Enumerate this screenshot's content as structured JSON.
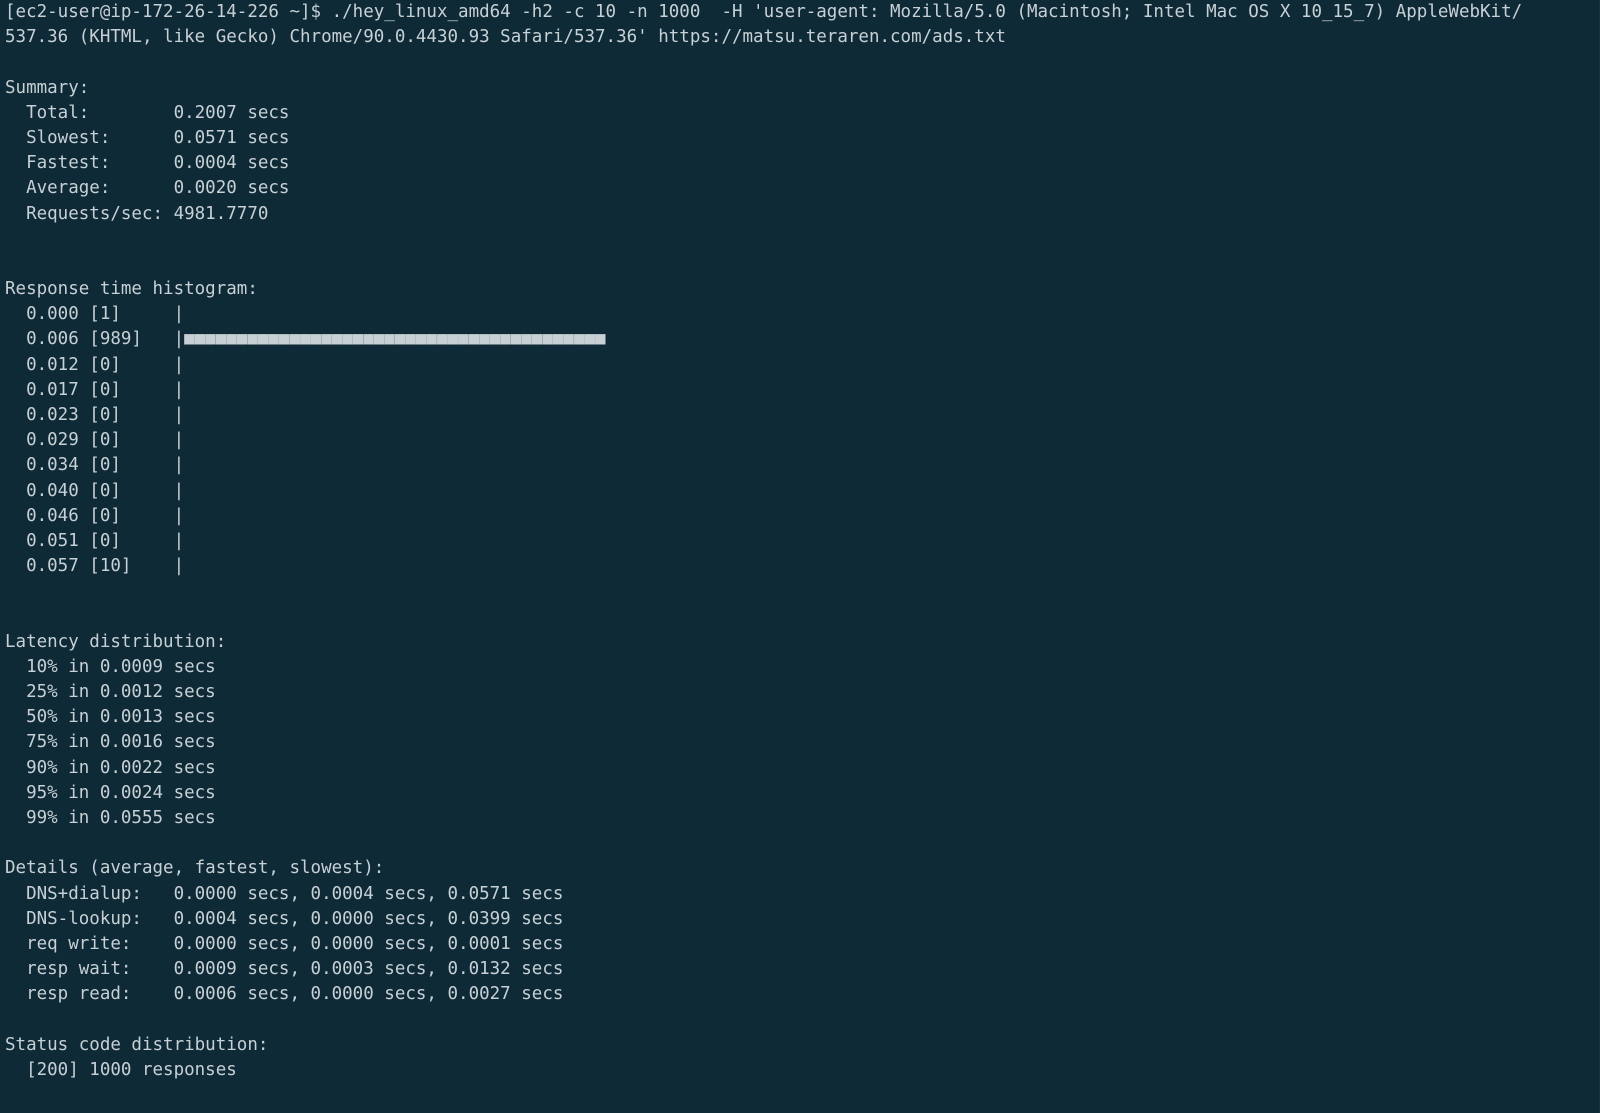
{
  "command": {
    "line1": "[ec2-user@ip-172-26-14-226 ~]$ ./hey_linux_amd64 -h2 -c 10 -n 1000  -H 'user-agent: Mozilla/5.0 (Macintosh; Intel Mac OS X 10_15_7) AppleWebKit/",
    "line2": "537.36 (KHTML, like Gecko) Chrome/90.0.4430.93 Safari/537.36' https://matsu.teraren.com/ads.txt"
  },
  "summary": {
    "heading": "Summary:",
    "lines": [
      "  Total:        0.2007 secs",
      "  Slowest:      0.0571 secs",
      "  Fastest:      0.0004 secs",
      "  Average:      0.0020 secs",
      "  Requests/sec: 4981.7770"
    ]
  },
  "histogram": {
    "heading": "Response time histogram:",
    "lines": [
      "  0.000 [1]     |",
      "  0.006 [989]   |■■■■■■■■■■■■■■■■■■■■■■■■■■■■■■■■■■■■■■■■",
      "  0.012 [0]     |",
      "  0.017 [0]     |",
      "  0.023 [0]     |",
      "  0.029 [0]     |",
      "  0.034 [0]     |",
      "  0.040 [0]     |",
      "  0.046 [0]     |",
      "  0.051 [0]     |",
      "  0.057 [10]    |"
    ]
  },
  "latency": {
    "heading": "Latency distribution:",
    "lines": [
      "  10% in 0.0009 secs",
      "  25% in 0.0012 secs",
      "  50% in 0.0013 secs",
      "  75% in 0.0016 secs",
      "  90% in 0.0022 secs",
      "  95% in 0.0024 secs",
      "  99% in 0.0555 secs"
    ]
  },
  "details": {
    "heading": "Details (average, fastest, slowest):",
    "lines": [
      "  DNS+dialup:   0.0000 secs, 0.0004 secs, 0.0571 secs",
      "  DNS-lookup:   0.0004 secs, 0.0000 secs, 0.0399 secs",
      "  req write:    0.0000 secs, 0.0000 secs, 0.0001 secs",
      "  resp wait:    0.0009 secs, 0.0003 secs, 0.0132 secs",
      "  resp read:    0.0006 secs, 0.0000 secs, 0.0027 secs"
    ]
  },
  "status": {
    "heading": "Status code distribution:",
    "lines": [
      "  [200] 1000 responses"
    ]
  },
  "colors": {
    "background": "#0e2a36",
    "foreground": "#c7d0d4"
  }
}
